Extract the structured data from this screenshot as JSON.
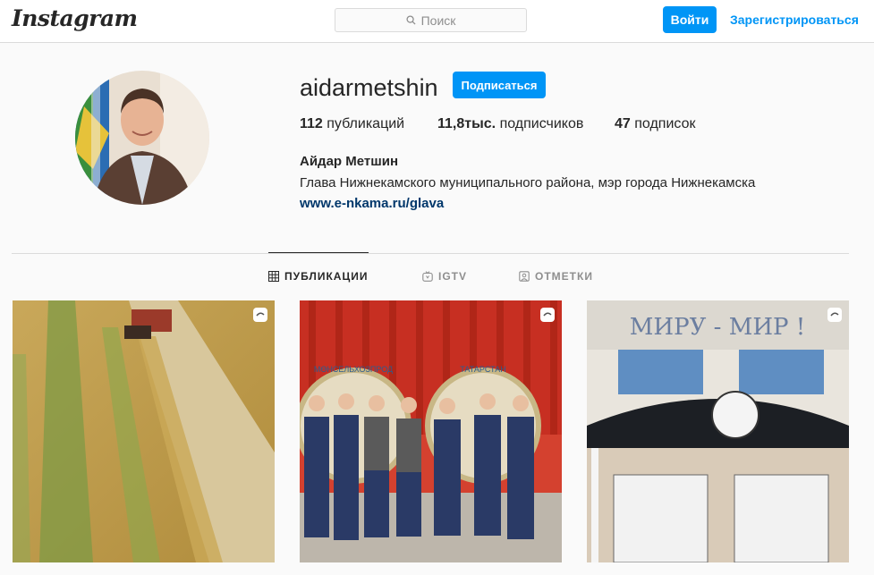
{
  "header": {
    "logo": "Instagram",
    "search_placeholder": "Поиск",
    "login_label": "Войти",
    "register_label": "Зарегистрироваться"
  },
  "profile": {
    "username": "aidarmetshin",
    "follow_label": "Подписаться",
    "stats": {
      "posts_count": "112",
      "posts_label": "публикаций",
      "followers_count": "11,8тыс.",
      "followers_label": "подписчиков",
      "following_count": "47",
      "following_label": "подписок"
    },
    "full_name": "Айдар Метшин",
    "bio": "Глава Нижнекамского муниципального района, мэр города Нижнекамска",
    "link": "www.e-nkama.ru/glava"
  },
  "tabs": [
    {
      "label": "ПУБЛИКАЦИИ",
      "icon": "grid-icon",
      "active": true
    },
    {
      "label": "IGTV",
      "icon": "igtv-icon",
      "active": false
    },
    {
      "label": "ОТМЕТКИ",
      "icon": "tagged-icon",
      "active": false
    }
  ],
  "posts": [
    {
      "icon": "video-icon",
      "alt_text": ""
    },
    {
      "icon": "video-icon",
      "banner_left": "МӨНСЕЛЬХОЗПРОД",
      "banner_right": "ТАТАРСТАН"
    },
    {
      "icon": "video-icon",
      "sign_text": "МИРУ - МИР !"
    }
  ],
  "colors": {
    "accent": "#0095f6",
    "link": "#00376b",
    "border": "#dbdbdb",
    "background": "#fafafa"
  }
}
